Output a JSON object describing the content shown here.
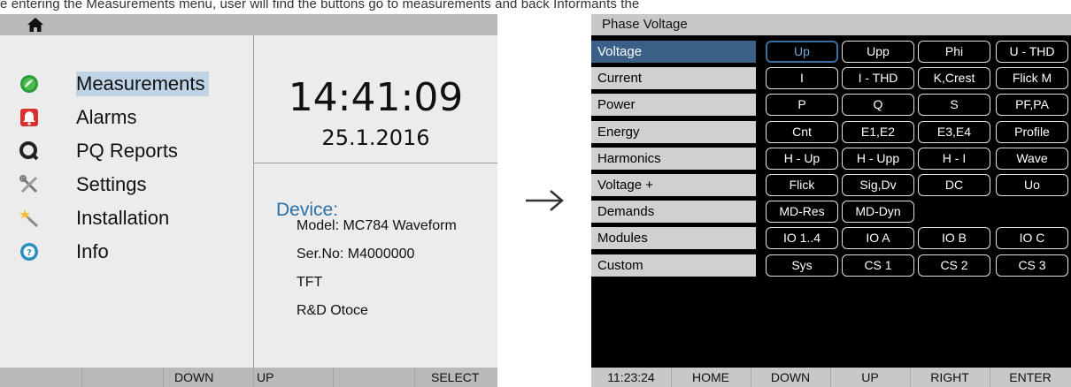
{
  "top_strip_text": "e entering the Measurements menu, user will find the buttons go to measurements and back Informants the",
  "left_screen": {
    "menu": [
      {
        "label": "Measurements",
        "icon": "measurements-icon",
        "selected": true
      },
      {
        "label": "Alarms",
        "icon": "alarm-bell-icon",
        "selected": false
      },
      {
        "label": "PQ Reports",
        "icon": "pq-reports-icon",
        "selected": false
      },
      {
        "label": "Settings",
        "icon": "settings-tools-icon",
        "selected": false
      },
      {
        "label": "Installation",
        "icon": "installation-wand-icon",
        "selected": false
      },
      {
        "label": "Info",
        "icon": "info-icon",
        "selected": false
      }
    ],
    "time": "14:41:09",
    "date": "25.1.2016",
    "device_title": "Device:",
    "device_lines": [
      "Model: MC784 Waveform",
      "Ser.No: M4000000",
      "TFT",
      "R&D Otoce"
    ],
    "footer": {
      "down": "DOWN",
      "up": "UP",
      "select": "SELECT"
    }
  },
  "right_screen": {
    "title": "Phase Voltage",
    "categories": [
      "Voltage",
      "Current",
      "Power",
      "Energy",
      "Harmonics",
      "Voltage +",
      "Demands",
      "Modules",
      "Custom"
    ],
    "selected_category": "Voltage",
    "grid": [
      [
        "Up",
        "Upp",
        "Phi",
        "U - THD"
      ],
      [
        "I",
        "I - THD",
        "K,Crest",
        "Flick M"
      ],
      [
        "P",
        "Q",
        "S",
        "PF,PA"
      ],
      [
        "Cnt",
        "E1,E2",
        "E3,E4",
        "Profile"
      ],
      [
        "H - Up",
        "H - Upp",
        "H - I",
        "Wave"
      ],
      [
        "Flick",
        "Sig,Dv",
        "DC",
        "Uo"
      ],
      [
        "MD-Res",
        "MD-Dyn",
        "",
        ""
      ],
      [
        "IO 1..4",
        "IO A",
        "IO B",
        "IO C"
      ],
      [
        "Sys",
        "CS 1",
        "CS 2",
        "CS 3"
      ]
    ],
    "selected_button": "Up",
    "footer": {
      "time": "11:23:24",
      "home": "HOME",
      "down": "DOWN",
      "up": "UP",
      "right": "RIGHT",
      "enter": "ENTER"
    }
  },
  "colors": {
    "selected_category": "#3b6088",
    "menu_highlight": "#bfd3e6",
    "device_title": "#2a6fa8"
  }
}
